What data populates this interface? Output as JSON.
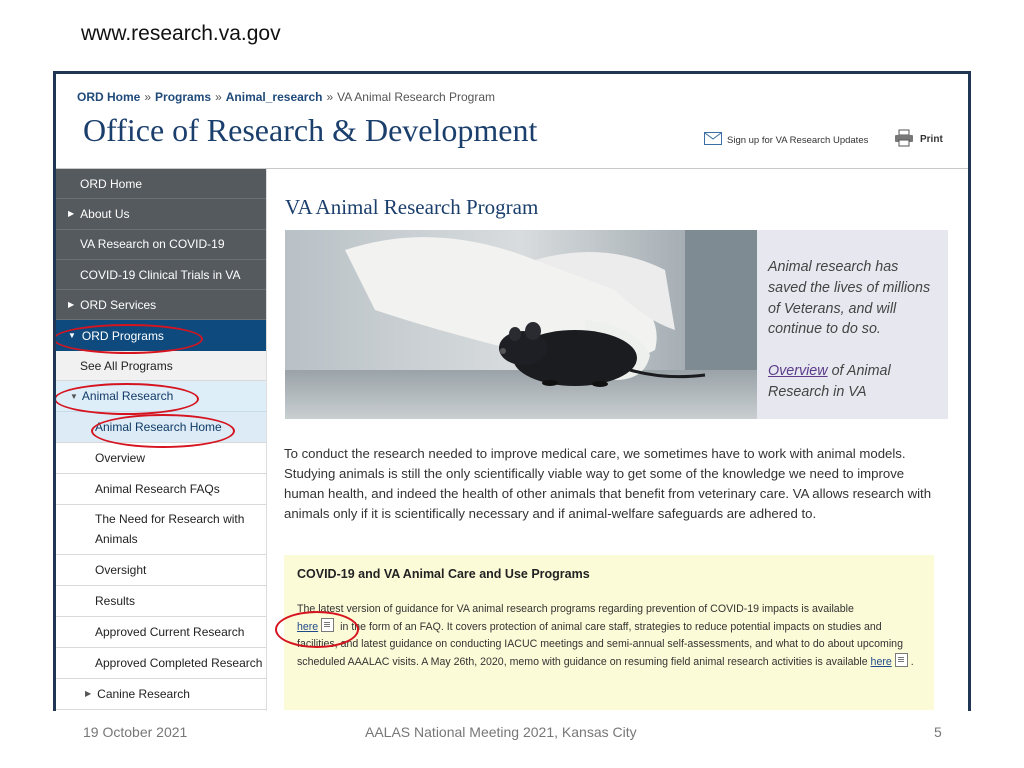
{
  "slide": {
    "url": "www.research.va.gov",
    "footer_date": "19 October 2021",
    "footer_event": "AALAS National Meeting 2021, Kansas City",
    "page_number": "5"
  },
  "header": {
    "breadcrumb": [
      "ORD Home",
      "Programs",
      "Animal_research",
      "VA Animal Research Program"
    ],
    "breadcrumb_sep": "»",
    "title": "Office of Research & Development",
    "signup_label": "Sign up for VA Research Updates",
    "print_label": "Print"
  },
  "sidebar": {
    "items": [
      {
        "label": "ORD Home"
      },
      {
        "label": "About Us"
      },
      {
        "label": "VA Research on COVID-19"
      },
      {
        "label": "COVID-19 Clinical Trials in VA"
      },
      {
        "label": "ORD Services"
      },
      {
        "label": "ORD Programs"
      },
      {
        "label": "See All Programs"
      },
      {
        "label": "Animal Research"
      },
      {
        "label": "Animal Research Home"
      },
      {
        "label": "Overview"
      },
      {
        "label": "Animal Research FAQs"
      },
      {
        "label": "The Need for Research with Animals"
      },
      {
        "label": "Oversight"
      },
      {
        "label": "Results"
      },
      {
        "label": "Approved Current Research"
      },
      {
        "label": "Approved Completed Research"
      },
      {
        "label": "Canine Research"
      }
    ]
  },
  "main": {
    "heading": "VA Animal Research Program",
    "hero_quote": "Animal research has saved the lives of millions of Veterans, and will continue to do so.",
    "hero_link": "Overview",
    "hero_link_tail": " of Animal Research in VA",
    "intro": "To conduct the research needed to improve medical care, we sometimes have to work with animal models. Studying animals is still the only scientifically viable way to get some of the knowledge we need to improve human health, and indeed the health of other animals that benefit from veterinary care. VA allows research with animals only if it is scientifically necessary and if animal-welfare safeguards are adhered to.",
    "covid": {
      "title": "COVID-19 and VA Animal Care and Use Programs",
      "p1": "The latest version of guidance for VA animal research programs regarding prevention of COVID-19 impacts is available",
      "link1": "here",
      "p2": " in the form of an FAQ. It covers protection of animal care staff, strategies to reduce potential impacts on studies and facilities, and latest guidance on conducting IACUC meetings and semi-annual self-assessments, and what to do about upcoming scheduled AAALAC visits. A May 26th, 2020, memo with guidance on resuming field animal research activities is available",
      "link2": "here",
      "p3": "."
    }
  },
  "colors": {
    "nav_dark": "#555a5e",
    "nav_active": "#0f4a7e",
    "title_blue": "#1b3f6c",
    "annotation_red": "#d6141f",
    "covid_box": "#fcfbd7"
  }
}
